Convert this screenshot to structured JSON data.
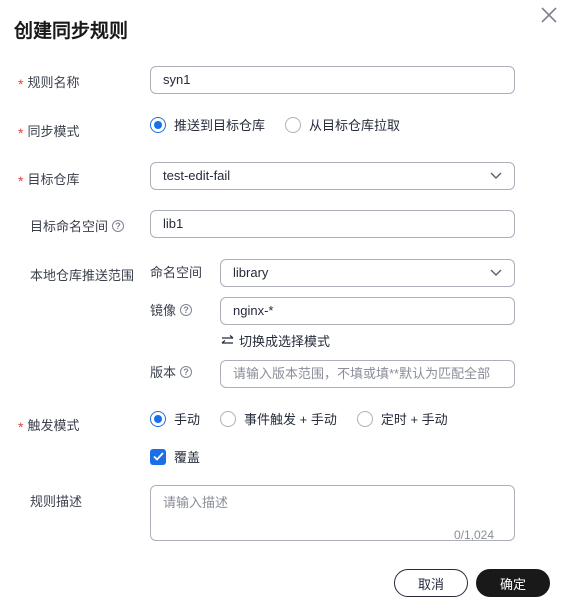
{
  "dialog": {
    "title": "创建同步规则",
    "close_icon": "close-icon"
  },
  "form": {
    "rule_name": {
      "label": "规则名称",
      "required": "*",
      "value": "syn1"
    },
    "sync_mode": {
      "label": "同步模式",
      "required": "*",
      "options": [
        "推送到目标仓库",
        "从目标仓库拉取"
      ],
      "selected": "推送到目标仓库"
    },
    "target_repo": {
      "label": "目标仓库",
      "required": "*",
      "value": "test-edit-fail"
    },
    "target_namespace": {
      "label": "目标命名空间",
      "help": "?",
      "value": "lib1"
    },
    "local_scope": {
      "label": "本地仓库推送范围",
      "namespace": {
        "label": "命名空间",
        "value": "library"
      },
      "image": {
        "label": "镜像",
        "help": "?",
        "value": "nginx-*"
      },
      "switch_mode": "切换成选择模式",
      "version": {
        "label": "版本",
        "help": "?",
        "placeholder": "请输入版本范围，不填或填**默认为匹配全部"
      }
    },
    "trigger_mode": {
      "label": "触发模式",
      "required": "*",
      "options": [
        "手动",
        "事件触发 + 手动",
        "定时 + 手动"
      ],
      "selected": "手动"
    },
    "overwrite": {
      "label": "覆盖",
      "checked": true
    },
    "description": {
      "label": "规则描述",
      "placeholder": "请输入描述",
      "counter": "0/1,024"
    }
  },
  "footer": {
    "cancel_label": "取消",
    "confirm_label": "确定"
  },
  "colors": {
    "accent": "#1a6fe8",
    "required": "#e8403a",
    "primary_button": "#191919"
  }
}
